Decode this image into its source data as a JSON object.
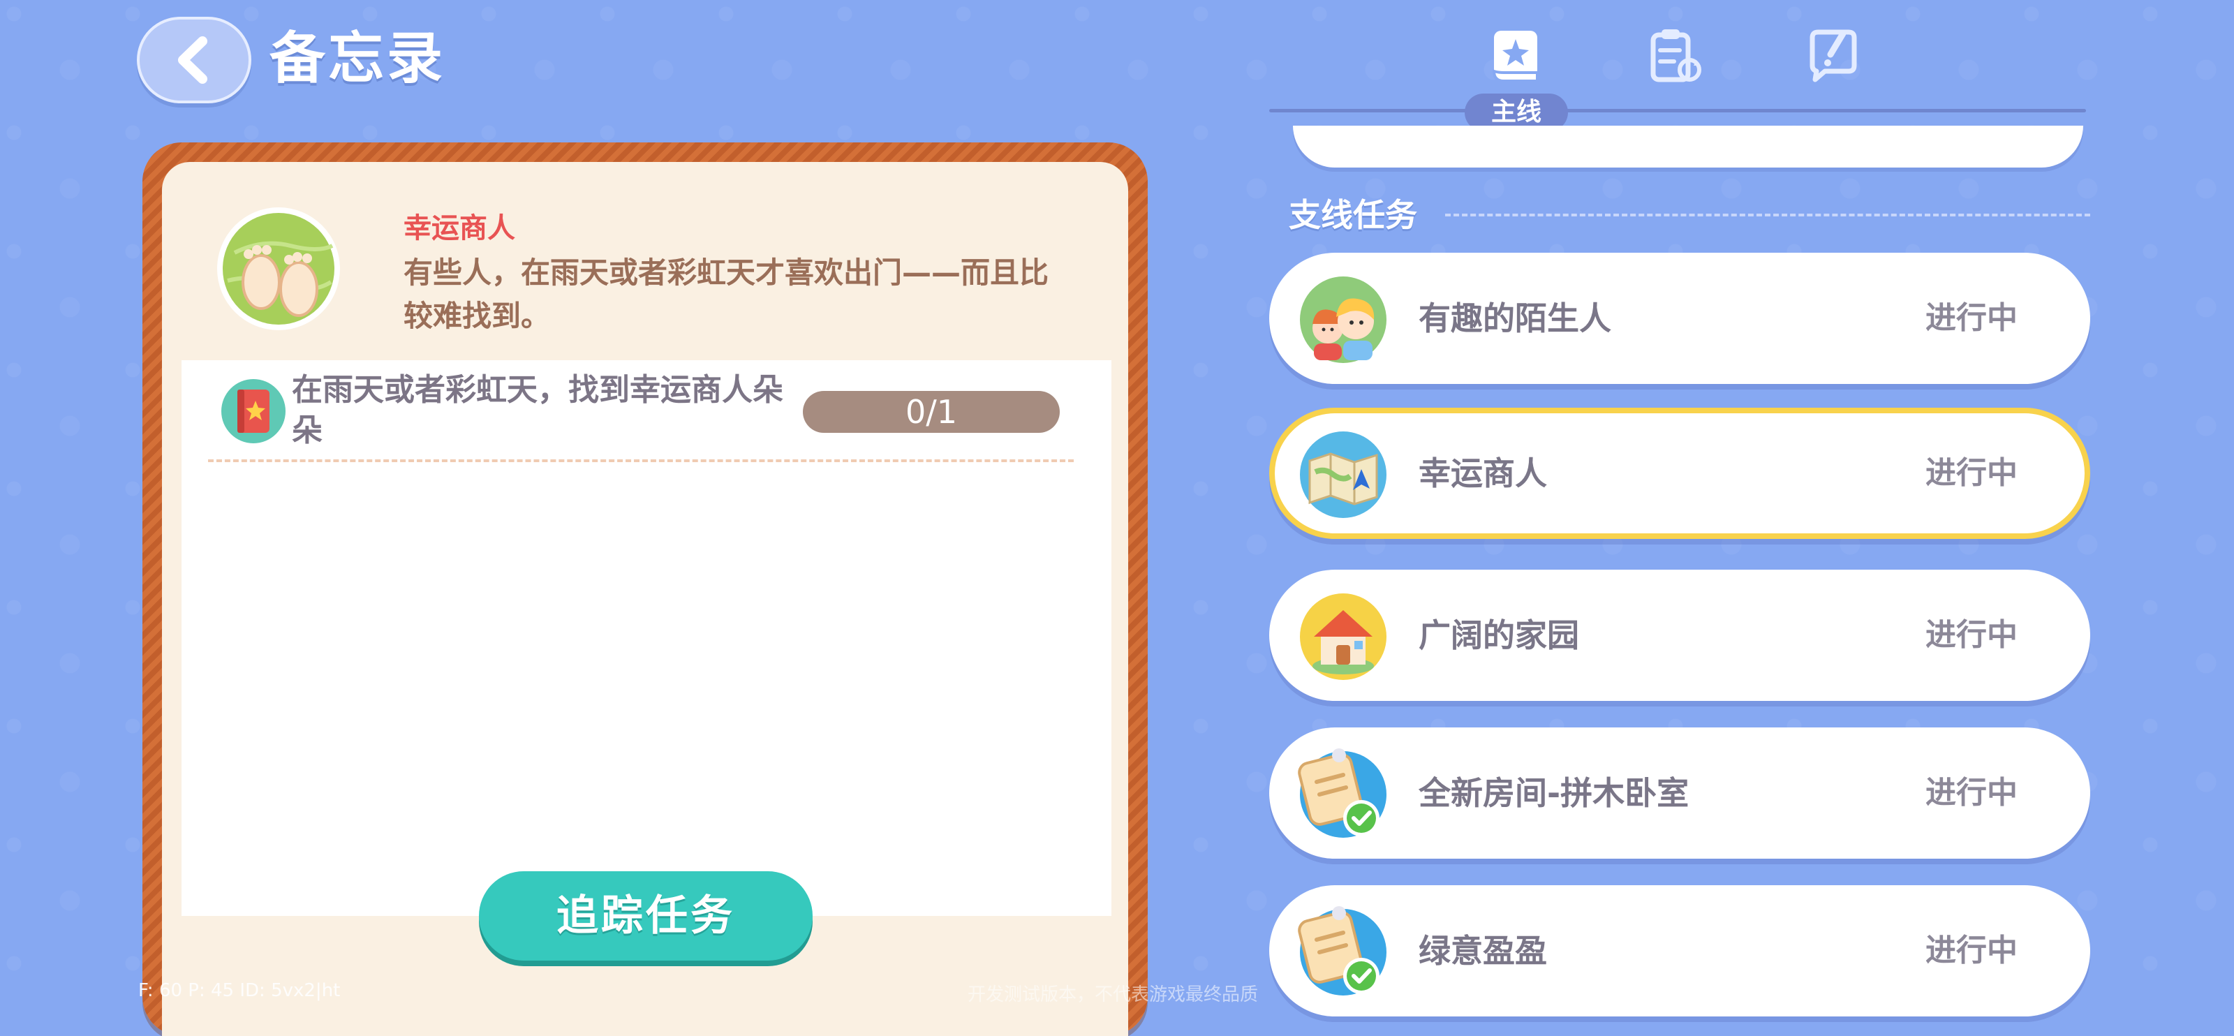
{
  "header": {
    "title": "备忘录",
    "back_icon": "chevron-left-icon"
  },
  "tabs": [
    {
      "icon": "main-quest-book-icon",
      "label": "主线",
      "active": true
    },
    {
      "icon": "task-clipboard-icon",
      "active": false
    },
    {
      "icon": "edit-note-icon",
      "active": false
    }
  ],
  "detail": {
    "name": "幸运商人",
    "description": "有些人，在雨天或者彩虹天才喜欢出门——而且比较难找到。",
    "icon": "footprints-globe-icon",
    "objective": {
      "text": "在雨天或者彩虹天，找到幸运商人朵朵",
      "icon": "red-book-icon",
      "progress": "0/1",
      "progress_fraction": 0
    },
    "track_button": "追踪任务"
  },
  "side_quests": {
    "title": "支线任务",
    "items": [
      {
        "name": "有趣的陌生人",
        "status": "进行中",
        "icon": "strangers-icon",
        "selected": false
      },
      {
        "name": "幸运商人",
        "status": "进行中",
        "icon": "map-icon",
        "selected": true
      },
      {
        "name": "广阔的家园",
        "status": "进行中",
        "icon": "house-icon",
        "selected": false
      },
      {
        "name": "全新房间-拼木卧室",
        "status": "进行中",
        "icon": "note-check-icon",
        "selected": false
      },
      {
        "name": "绿意盈盈",
        "status": "进行中",
        "icon": "note-check-icon",
        "selected": false
      }
    ]
  },
  "debug": {
    "stats": "F: 60    P: 45    ID: 5vx2|ht",
    "notice": "开发测试版本，不代表游戏最终品质"
  },
  "colors": {
    "background": "#86a8f2",
    "accent_teal": "#36c9bd",
    "highlight_yellow": "#f8d24c",
    "quest_name_red": "#e85353",
    "frame_orange": "#c25f2c"
  }
}
